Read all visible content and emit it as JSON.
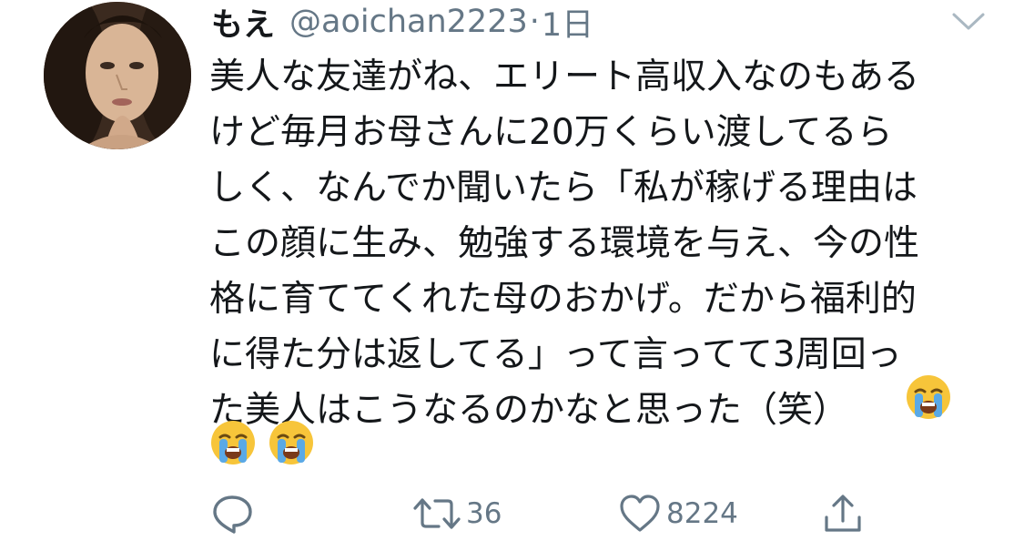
{
  "tweet": {
    "display_name": "もえ",
    "handle": "@aoichan2223",
    "separator": "·",
    "time": "1日",
    "text_lines": [
      "美人な友達がね、エリート高収入なのもある",
      "けど毎月お母さんに20万くらい渡してるら",
      "しく、なんでか聞いたら「私が稼げる理由は",
      "この顔に生み、勉強する環境を与え、今の性",
      "格に育ててくれた母のおかげ。だから福利的",
      "に得た分は返してる」って言ってて3周回っ",
      "た美人はこうなるのかなと思った（笑）"
    ]
  },
  "actions": {
    "reply_count": "",
    "retweet_count": "36",
    "like_count": "8224"
  },
  "icons": {
    "reply": "reply-icon",
    "retweet": "retweet-icon",
    "like": "heart-icon",
    "share": "share-icon",
    "caret": "chevron-down-icon",
    "emoji": "loudly-crying-face-emoji"
  },
  "colors": {
    "text": "#14171a",
    "secondary": "#657786",
    "emoji_face": "#f7c53a",
    "emoji_tears": "#5aa9e6"
  }
}
